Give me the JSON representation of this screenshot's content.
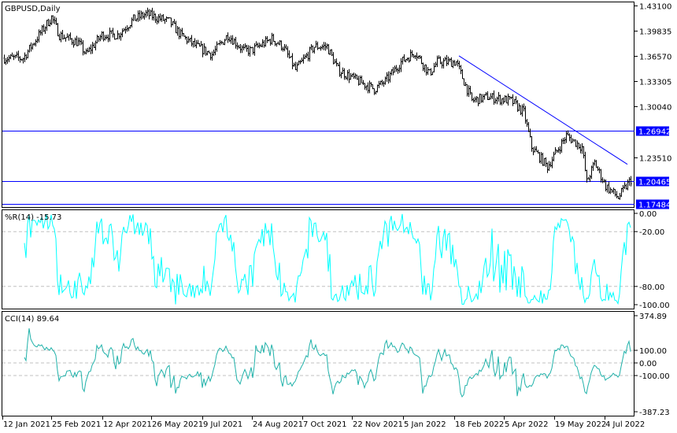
{
  "window": {
    "symbol_title": "GBPUSD,Daily"
  },
  "colors": {
    "bars": "#000000",
    "lines": "#0000ff",
    "wr": "#00ffff",
    "cci": "#20b2aa",
    "grid": "#c0c0c0",
    "label_bg": "#0000ff"
  },
  "chart_data": [
    {
      "type": "line",
      "title": "GBPUSD,Daily",
      "series_name": "GBPUSD close (approx., OHLC bars)",
      "price_axis_ticks": [
        "1.43100",
        "1.39835",
        "1.36570",
        "1.33305",
        "1.30040",
        "1.23510"
      ],
      "ylim": [
        1.17484,
        1.431
      ],
      "x_ticks": [
        "12 Jan 2021",
        "25 Feb 2021",
        "12 Apr 2021",
        "26 May 2021",
        "9 Jul 2021",
        "24 Aug 2021",
        "7 Oct 2021",
        "22 Nov 2021",
        "5 Jan 2022",
        "18 Feb 2022",
        "5 Apr 2022",
        "19 May 2022",
        "4 Jul 2022"
      ],
      "keypoints_bar_price": [
        [
          0,
          1.363
        ],
        [
          12,
          1.363
        ],
        [
          17,
          1.378
        ],
        [
          30,
          1.416
        ],
        [
          35,
          1.393
        ],
        [
          47,
          1.383
        ],
        [
          52,
          1.368
        ],
        [
          62,
          1.393
        ],
        [
          72,
          1.393
        ],
        [
          82,
          1.413
        ],
        [
          90,
          1.42
        ],
        [
          105,
          1.41
        ],
        [
          112,
          1.393
        ],
        [
          122,
          1.378
        ],
        [
          132,
          1.368
        ],
        [
          142,
          1.393
        ],
        [
          152,
          1.373
        ],
        [
          157,
          1.373
        ],
        [
          170,
          1.388
        ],
        [
          177,
          1.378
        ],
        [
          185,
          1.348
        ],
        [
          197,
          1.378
        ],
        [
          205,
          1.378
        ],
        [
          212,
          1.348
        ],
        [
          225,
          1.333
        ],
        [
          235,
          1.323
        ],
        [
          242,
          1.333
        ],
        [
          252,
          1.358
        ],
        [
          261,
          1.371
        ],
        [
          270,
          1.343
        ],
        [
          275,
          1.358
        ],
        [
          287,
          1.358
        ],
        [
          297,
          1.308
        ],
        [
          307,
          1.313
        ],
        [
          322,
          1.308
        ],
        [
          330,
          1.293
        ],
        [
          335,
          1.248
        ],
        [
          345,
          1.223
        ],
        [
          357,
          1.263
        ],
        [
          367,
          1.248
        ],
        [
          370,
          1.203
        ],
        [
          375,
          1.228
        ],
        [
          382,
          1.198
        ],
        [
          390,
          1.183
        ],
        [
          398,
          1.206
        ]
      ],
      "horizontal_levels": [
        {
          "label": "1.26942",
          "value": 1.26942
        },
        {
          "label": "1.20465",
          "value": 1.20465
        },
        {
          "label": "1.17484",
          "value": 1.17484
        }
      ],
      "trendline": {
        "from": [
          289,
          1.366
        ],
        "to": [
          396,
          1.226
        ]
      }
    },
    {
      "type": "line",
      "title": "%R(14) -15.73",
      "last_value": -15.73,
      "ylim": [
        -100,
        0
      ],
      "ticks": [
        "0.00",
        "-20.00",
        "-80.00",
        "-100.00"
      ],
      "levels": [
        -20,
        -80
      ]
    },
    {
      "type": "line",
      "title": "CCI(14) 89.64",
      "last_value": 89.64,
      "ylim": [
        -387.23,
        374.89
      ],
      "ticks": [
        "374.89",
        "100.00",
        "0.00",
        "-100.00",
        "-387.23"
      ],
      "levels": [
        100,
        0,
        -100
      ]
    }
  ]
}
